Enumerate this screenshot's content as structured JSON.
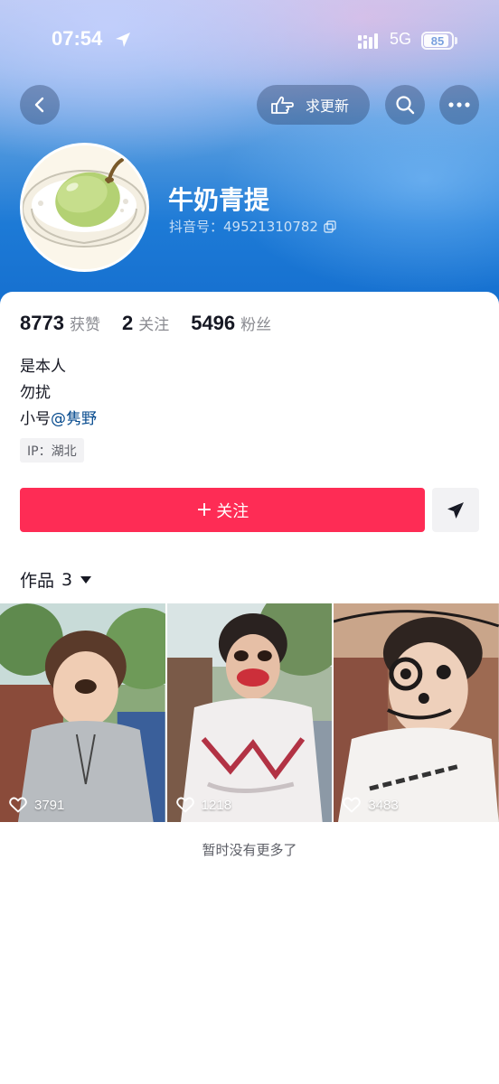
{
  "status_bar": {
    "time": "07:54",
    "network": "5G",
    "battery": "85"
  },
  "top_bar": {
    "update_request_label": "求更新"
  },
  "profile": {
    "nickname": "牛奶青提",
    "douyin_id": "抖音号：49521310782"
  },
  "stats": [
    {
      "value": "8773",
      "label": "获赞"
    },
    {
      "value": "2",
      "label": "关注"
    },
    {
      "value": "5496",
      "label": "粉丝"
    }
  ],
  "bio": {
    "line1": "是本人",
    "line2": "勿扰",
    "line3_prefix": "小号",
    "line3_mention": "@隽野",
    "ip": "IP：湖北"
  },
  "actions": {
    "follow_label": "关注"
  },
  "works": {
    "tab_label": "作品",
    "count": "3",
    "items": [
      {
        "likes": "3791"
      },
      {
        "likes": "1218"
      },
      {
        "likes": "3483"
      }
    ],
    "end_text": "暂时没有更多了"
  },
  "colors": {
    "follow": "#fe2c55",
    "mention": "#04498d",
    "header": "#1d7ad6"
  },
  "icons": [
    "back-icon",
    "hand-pointer-icon",
    "search-icon",
    "more-icon",
    "copy-icon",
    "send-icon",
    "heart-icon",
    "location-arrow-icon"
  ]
}
